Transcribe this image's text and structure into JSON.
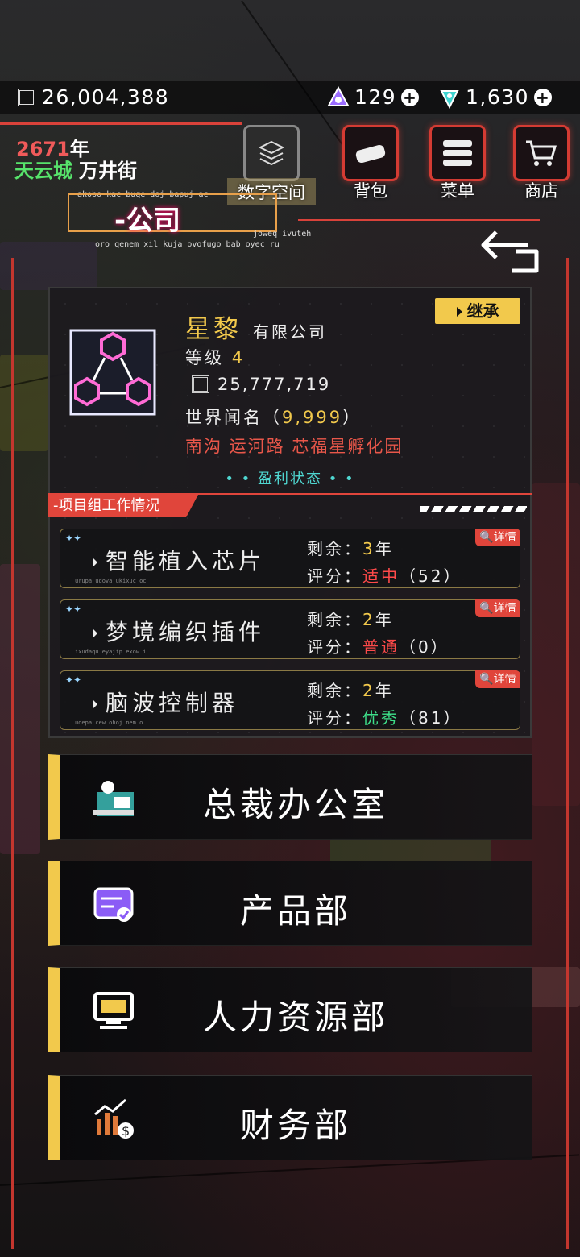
{
  "currency": {
    "money": "26,004,388",
    "crystal": "129",
    "diamond": "1,630"
  },
  "header": {
    "year_num": "2671",
    "year_unit": "年",
    "city": "天云城",
    "street": "万井街"
  },
  "nav": {
    "digital_space": "数字空间",
    "bag": "背包",
    "menu": "菜单",
    "shop": "商店"
  },
  "page": {
    "title": "-公司",
    "tiny_top": "akobo kac buqe doj bapuj ac",
    "tiny_right": "joweq ivuteh",
    "tiny_bottom": "oro qenem xil kuja ovofugo bab oyec ru"
  },
  "company": {
    "name": "星黎",
    "suffix": "有限公司",
    "inherit_label": "继承",
    "level_label": "等级",
    "level": "4",
    "cash": "25,777,719",
    "fame_label": "世界闻名（",
    "fame_value": "9,999",
    "fame_close": "）",
    "address": "南沟 运河路 芯福星孵化园",
    "status": "• • 盈利状态 • •"
  },
  "projects_section": {
    "title": "-项目组工作情况",
    "remaining_label": "剩余：",
    "score_label": "评分：",
    "detail_label": "详情",
    "items": [
      {
        "name": "智能植入芯片",
        "years": "3",
        "year_unit": "年",
        "grade": "适中",
        "grade_color": "#ff4a4a",
        "score": "（52）",
        "sub": "urupa udova ukixuc oc"
      },
      {
        "name": "梦境编织插件",
        "years": "2",
        "year_unit": "年",
        "grade": "普通",
        "grade_color": "#ff4a4a",
        "score": "（0）",
        "sub": "ixudaqu eyajip exow i"
      },
      {
        "name": "脑波控制器",
        "years": "2",
        "year_unit": "年",
        "grade": "优秀",
        "grade_color": "#3ee08a",
        "score": "（81）",
        "sub": "udepa cew ohoj nem o"
      }
    ]
  },
  "departments": [
    {
      "name": "总裁办公室",
      "icon": "ceo-office-icon"
    },
    {
      "name": "产品部",
      "icon": "product-icon"
    },
    {
      "name": "人力资源部",
      "icon": "hr-icon"
    },
    {
      "name": "财务部",
      "icon": "finance-icon"
    }
  ],
  "colors": {
    "accent_red": "#e0453b",
    "accent_yellow": "#f2c94c",
    "teal": "#4fd6d0",
    "green": "#57e36b"
  }
}
